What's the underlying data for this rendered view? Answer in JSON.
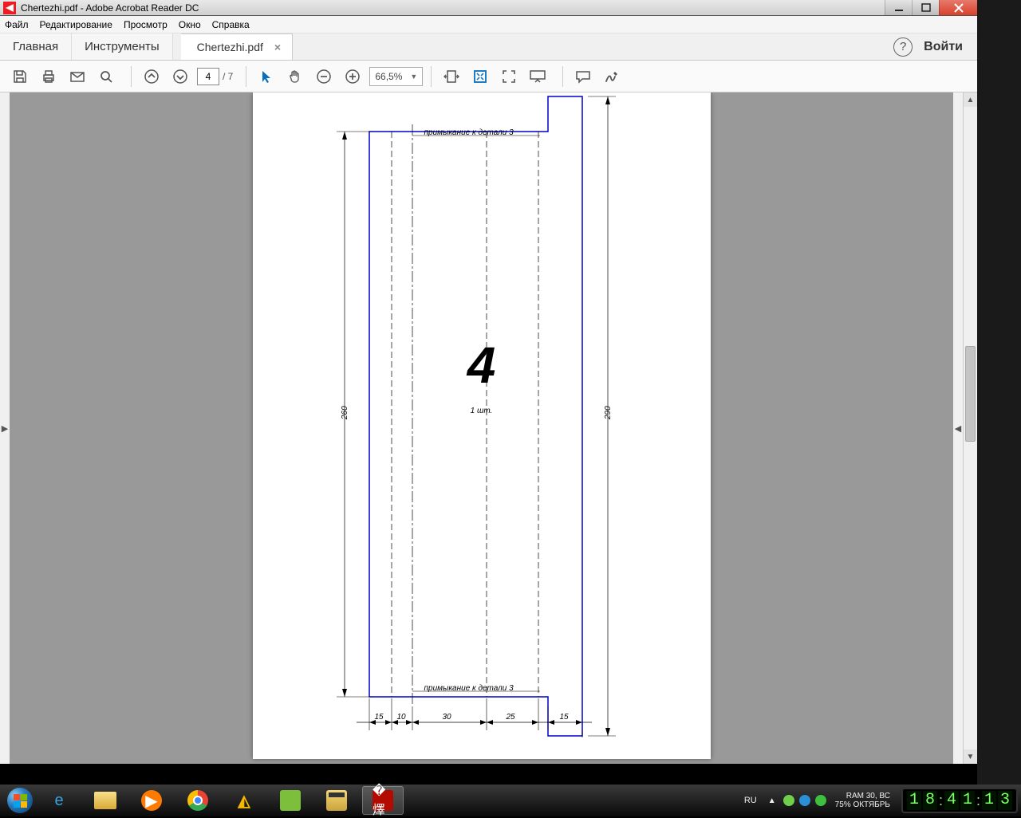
{
  "titlebar": {
    "title": "Chertezhi.pdf - Adobe Acrobat Reader DC"
  },
  "menu": {
    "file": "Файл",
    "edit": "Редактирование",
    "view": "Просмотр",
    "window": "Окно",
    "help": "Справка"
  },
  "tabs": {
    "home": "Главная",
    "tools": "Инструменты",
    "doc": "Chertezhi.pdf",
    "close_x": "×",
    "help_q": "?",
    "login": "Войти"
  },
  "toolbar": {
    "page_current": "4",
    "page_total": "/ 7",
    "zoom": "66,5%"
  },
  "drawing": {
    "big_no": "4",
    "qty": "1 шт.",
    "note_top": "примыкание к детали 3",
    "note_bottom": "примыкание к детали 3",
    "h_left": "260",
    "h_right": "290",
    "d1": "15",
    "d2": "10",
    "d3": "30",
    "d4": "25",
    "d5": "15"
  },
  "taskbar": {
    "lang": "RU",
    "sys_line1": "RAM   30, ВС",
    "sys_line2": "75%  ОКТЯБРЬ",
    "clock": "18:41:13"
  }
}
